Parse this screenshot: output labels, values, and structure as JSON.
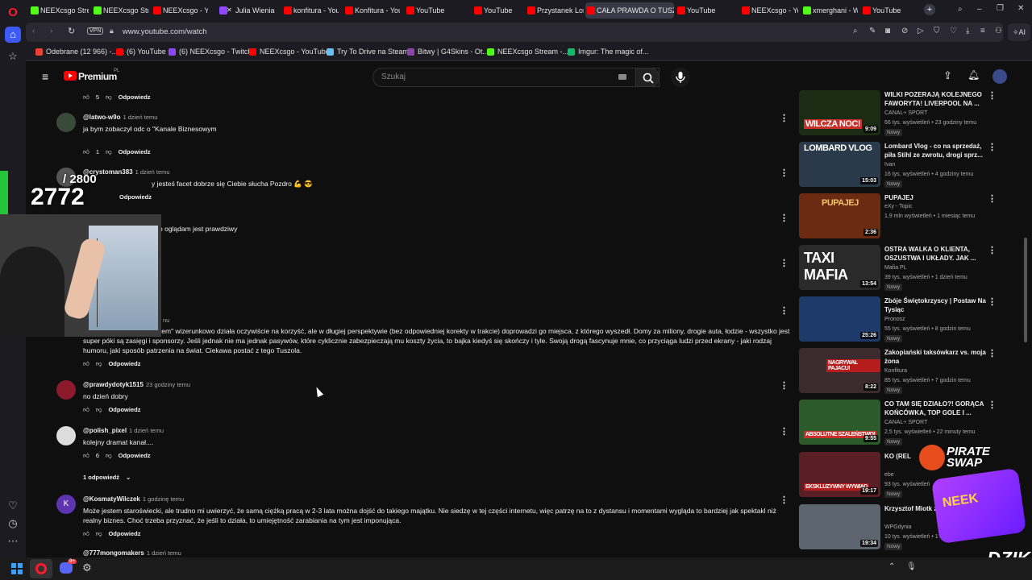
{
  "browser": {
    "tabs": [
      {
        "label": "NEEXcsgo Strea",
        "fav": "kick"
      },
      {
        "label": "NEEXcsgo Strea",
        "fav": "kick"
      },
      {
        "label": "NEEXcsgo - You",
        "fav": "yt"
      },
      {
        "label": "Julia Wienia",
        "fav": "tw"
      },
      {
        "label": "konfitura - YouT",
        "fav": "yt"
      },
      {
        "label": "Konfitura - YouT",
        "fav": "yt"
      },
      {
        "label": "YouTube",
        "fav": "yt"
      },
      {
        "label": "YouTube",
        "fav": "yt"
      },
      {
        "label": "Przystanek Lon",
        "fav": "yt"
      },
      {
        "label": "CAŁA PRAWDA O TUSZOL",
        "fav": "yt",
        "active": true
      },
      {
        "label": "YouTube",
        "fav": "yt"
      },
      {
        "label": "NEEXcsgo - Yo",
        "fav": "yt"
      },
      {
        "label": "xmerghani - W",
        "fav": "kick"
      },
      {
        "label": "YouTube",
        "fav": "yt"
      }
    ],
    "vpn_label": "VPN",
    "url": "www.youtube.com/watch",
    "ai_label": "AI",
    "bookmarks": [
      {
        "label": "Odebrane (12 966) -...",
        "color": "#ea4335"
      },
      {
        "label": "(6) YouTube",
        "color": "#ff0000"
      },
      {
        "label": "(6) NEEXcsgo - Twitch",
        "color": "#9146ff"
      },
      {
        "label": "NEEXcsgo - YouTube",
        "color": "#ff0000"
      },
      {
        "label": "Try To Drive na Steam",
        "color": "#66c0f4"
      },
      {
        "label": "Bitwy | G4Skins - Ot...",
        "color": "#8e44ad"
      },
      {
        "label": "NEEXcsgo Stream -...",
        "color": "#53fc18"
      },
      {
        "label": "Imgur: The magic of...",
        "color": "#1bb76e"
      }
    ]
  },
  "youtube": {
    "logo_text": "Premium",
    "logo_region": "PL",
    "search_placeholder": "Szukaj"
  },
  "comments": {
    "top_actions": {
      "likes": "5",
      "reply": "Odpowiedz"
    },
    "items": [
      {
        "handle": "@latwo-w9o",
        "when": "1 dzień temu",
        "text": "ja bym zobaczył odc o \"Kanale Biznesowym",
        "likes": "1",
        "reply": "Odpowiedz"
      },
      {
        "handle": "@crystoman383",
        "when": "1 dzień temu",
        "text": "y jesteś facet dobrze się Ciebie słucha Pozdro 💪 😎",
        "likes": "",
        "reply": "Odpowiedz"
      },
      {
        "text": "o oglądam jest prawdziwy"
      },
      {
        "when": "nu",
        "text": "ostał tym samym chłopakiem\" wizerunkowo działa oczywiście na korzyść, ale w długiej perspektywie (bez odpowiedniej korekty w trakcie) doprowadzi go miejsca, z którego wyszedł. Domy za miliony, drogie auta, łodzie - wszystko jest super póki są zasięgi i sponsorzy. Jeśli jednak nie ma jednak pasywów, które cyklicznie zabezpieczają mu koszty życia, to bajka kiedyś się skończy i tyle. Swoją drogą fascynuje mnie, co przyciąga ludzi przed ekrany - jaki rodzaj humoru, jaki sposób patrzenia na świat. Ciekawa postać z tego Tuszola.",
        "reply": "Odpowiedz"
      },
      {
        "handle": "@prawdydotyk1515",
        "when": "23 godziny temu",
        "text": "no dzień dobry",
        "reply": "Odpowiedz"
      },
      {
        "handle": "@polish_pixel",
        "when": "1 dzień temu",
        "text": "kolejny dramat kanał....",
        "likes": "6",
        "reply": "Odpowiedz",
        "replies_toggle": "1 odpowiedź"
      },
      {
        "handle": "@KosmatyWilczek",
        "when": "1 godzinę temu",
        "avatar_letter": "K",
        "text": "Może jestem staroświecki, ale trudno mi uwierzyć, że samą ciężką pracą w 2-3 lata można dojść do takiego majątku. Nie siedzę w tej części internetu, więc patrzę na to z dystansu i momentami wygląda to bardziej jak spektakl niż realny biznes. Choć trzeba przyznać, że jeśli to działa, to umiejętność zarabiania na tym jest imponująca.",
        "reply": "Odpowiedz"
      },
      {
        "handle": "@777mongomakers",
        "when": "1 dzień temu"
      }
    ]
  },
  "recommended": [
    {
      "title": "WILKI POZERAJĄ KOLEJNEGO FAWORYTA! LIVERPOOL NA ...",
      "channel": "CANAL+ SPORT",
      "meta": "66 tys. wyświetleń • 23 godziny temu",
      "badge": "Nowy",
      "duration": "9:09",
      "thumb_text": "WILCZA NOC!",
      "thumb_color": "#1a2d14"
    },
    {
      "title": "Lombard Vlog - co na sprzedaż, piła Stihl ze zwrotu, drogi sprz...",
      "channel": "Ivan",
      "meta": "16 tys. wyświetleń • 4 godziny temu",
      "badge": "Nowy",
      "duration": "15:03",
      "thumb_text": "LOMBARD VLOG",
      "thumb_color": "#2b3a4a"
    },
    {
      "title": "PUPAJEJ",
      "channel": "eXy - Topic",
      "meta": "1,9 mln wyświetleń • 1 miesiąc temu",
      "badge": "",
      "duration": "2:36",
      "thumb_text": "PUPAJEJ",
      "thumb_color": "#6b2b12"
    },
    {
      "title": "OSTRA WALKA O KLIENTA, OSZUSTWA I UKŁADY. JAK ...",
      "channel": "Mafia PL",
      "meta": "39 tys. wyświetleń • 1 dzień temu",
      "badge": "Nowy",
      "duration": "13:54",
      "thumb_text": "TAXI MAFIA",
      "thumb_color": "#2a2a2a"
    },
    {
      "title": "Zbóje Świętokrzyscy | Postaw Na Tysiąc",
      "channel": "Pronosz",
      "meta": "55 tys. wyświetleń • 8 godzin temu",
      "badge": "Nowy",
      "duration": "25:26",
      "thumb_text": "",
      "thumb_color": "#1d3a6b"
    },
    {
      "title": "Zakopiański taksówkarz vs. moja żona",
      "channel": "Konfitura",
      "meta": "85 tys. wyświetleń • 7 godzin temu",
      "badge": "Nowy",
      "duration": "8:22",
      "thumb_text": "NAGRYWAŁ PAJACU!",
      "thumb_color": "#3b2a2e"
    },
    {
      "title": "CO TAM SIĘ DZIAŁO?! GORĄCA KOŃCÓWKA, TOP GOLE I ...",
      "channel": "CANAL+ SPORT",
      "meta": "2,5 tys. wyświetleń • 22 minuty temu",
      "badge": "Nowy",
      "duration": "9:55",
      "thumb_text": "ABSOLUTNE SZALEŃSTWO!",
      "thumb_color": "#2d5a2a"
    },
    {
      "title": "KO (REL",
      "channel": "ebe",
      "meta": "93 tys. wyświetleń",
      "badge": "Nowy",
      "duration": "19:17",
      "thumb_text": "EKSKLUZYWNY WYWIAD",
      "thumb_color": "#5a1f24"
    },
    {
      "title": "Krzysztof Miotk zaufania użytk",
      "channel": "WPGdynia",
      "meta": "10 tys. wyświetleń • 1 dzień temu",
      "badge": "Nowy",
      "duration": "19:34",
      "thumb_text": "",
      "thumb_color": "#5c6470"
    }
  ],
  "overlay": {
    "counter_goal": "/ 2800",
    "counter_value": "2772",
    "sponsor_1": "PIRATE SWAP",
    "sponsor_2": "DZIK",
    "neek_text": "NEEK"
  },
  "taskbar": {
    "discord_badge": "9+"
  }
}
